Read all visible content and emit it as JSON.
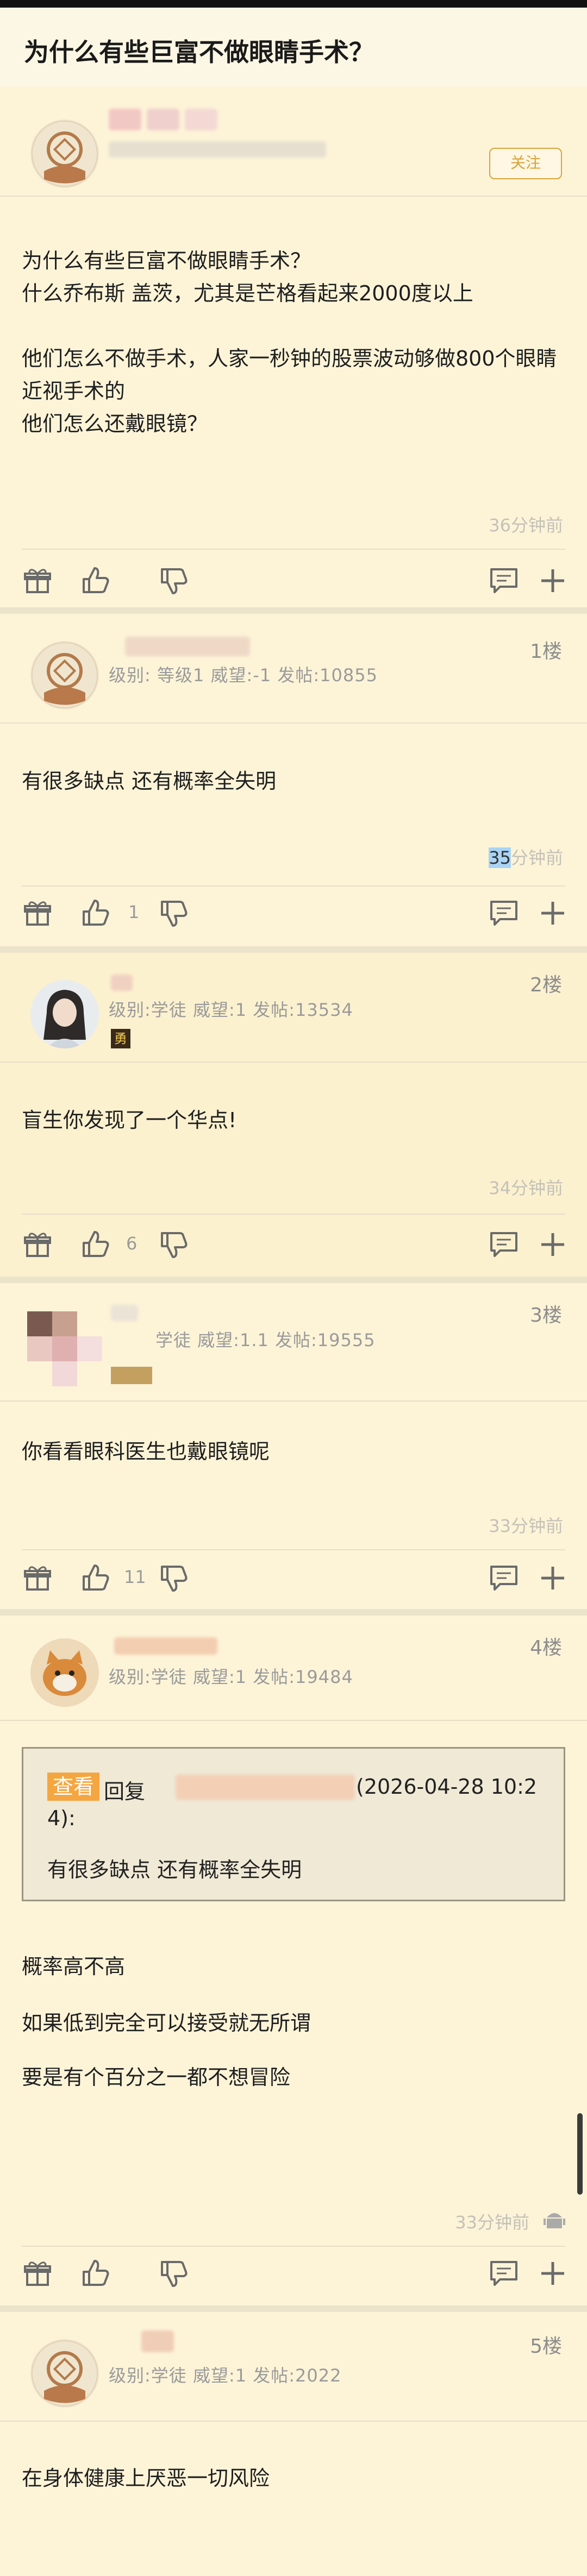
{
  "page": {
    "title": "为什么有些巨富不做眼睛手术？"
  },
  "op": {
    "follow_label": "关注",
    "content": "为什么有些巨富不做眼睛手术？\n什么乔布斯 盖茨，尤其是芒格看起来2000度以上\n\n他们怎么不做手术，人家一秒钟的股票波动够做800个眼睛近视手术的\n他们怎么还戴眼镜？",
    "time": "36分钟前"
  },
  "posts": [
    {
      "floor": "1楼",
      "meta": "级别:  等级1 威望:-1 发帖:10855",
      "content": "有很多缺点 还有概率全失明",
      "time_num": "35",
      "time_suffix": "分钟前",
      "likes": "1"
    },
    {
      "floor": "2楼",
      "meta": "级别:学徒 威望:1 发帖:13534",
      "badge": "勇",
      "content": "盲生你发现了一个华点!",
      "time": "34分钟前",
      "likes": "6"
    },
    {
      "floor": "3楼",
      "meta": "学徒 威望:1.1 发帖:19555",
      "content": "你看看眼科医生也戴眼镜呢",
      "time": "33分钟前",
      "likes": "11"
    },
    {
      "floor": "4楼",
      "meta": "级别:学徒 威望:1 发帖:19484",
      "quote": {
        "tag": "查看",
        "reply_label": "回复",
        "date_line": "(2026-04-28 10:2",
        "date_line2": "4):",
        "text": "有很多缺点 还有概率全失明"
      },
      "content_lines": [
        "概率高不高",
        "如果低到完全可以接受就无所谓",
        "要是有个百分之一都不想冒险"
      ],
      "time": "33分钟前",
      "likes": ""
    },
    {
      "floor": "5楼",
      "meta": "级别:学徒 威望:1 发帖:2022",
      "content": "在身体健康上厌恶一切风险"
    }
  ],
  "icons": {
    "gift": "gift-icon",
    "like": "thumbs-up-icon",
    "dislike": "thumbs-down-icon",
    "comment": "comment-icon",
    "add": "plus-icon",
    "android": "android-icon"
  },
  "colors": {
    "accent": "#d9a33a",
    "quote_tag": "#f5a640",
    "background": "#fcf6e4"
  }
}
